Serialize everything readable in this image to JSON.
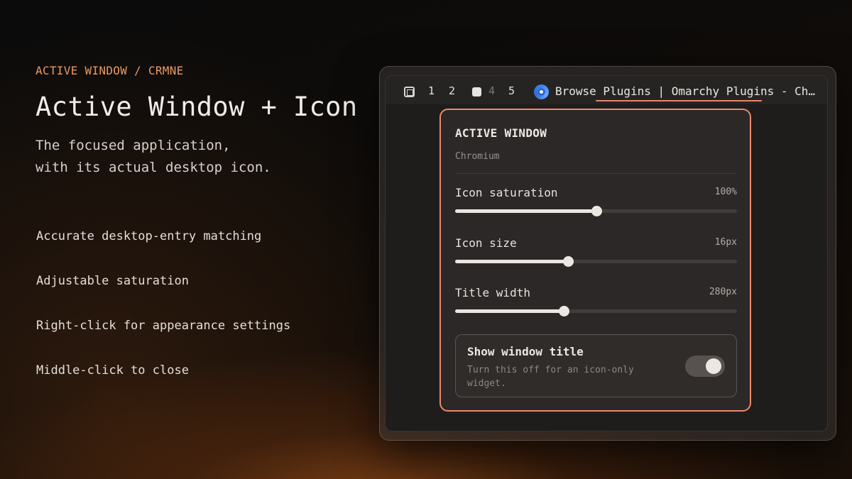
{
  "intro": {
    "eyebrow": "ACTIVE WINDOW / CRMNE",
    "title": "Active Window + Icon",
    "subtitle_lines": [
      "The focused application,",
      "with its actual desktop icon."
    ],
    "features": [
      "Accurate desktop-entry matching",
      "Adjustable saturation",
      "Right-click for appearance settings",
      "Middle-click to close"
    ]
  },
  "topbar": {
    "workspaces": [
      "1",
      "2",
      "",
      "4",
      "5"
    ],
    "active_workspace_index": 2,
    "window_icon": "chromium-icon",
    "window_title": "Browse Plugins | Omarchy Plugins - Ch…"
  },
  "panel": {
    "heading": "ACTIVE WINDOW",
    "app_name": "Chromium",
    "settings": [
      {
        "label": "Icon saturation",
        "value": "100%",
        "fraction": 0.5
      },
      {
        "label": "Icon size",
        "value": "16px",
        "fraction": 0.4
      },
      {
        "label": "Title width",
        "value": "280px",
        "fraction": 0.385
      }
    ],
    "toggle": {
      "title": "Show window title",
      "description": "Turn this off for an icon-only widget.",
      "on": true
    }
  },
  "colors": {
    "accent": "#e89a63",
    "panel_border": "#ea8a6c",
    "background": "#0b0b0b"
  }
}
